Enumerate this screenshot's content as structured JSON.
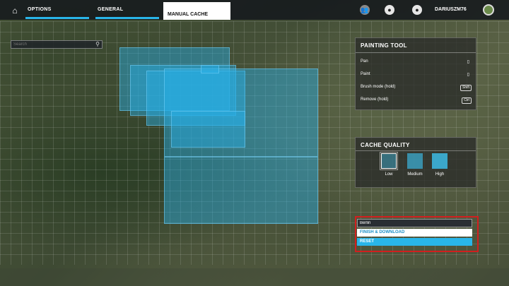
{
  "topbar": {
    "tabs": [
      "OPTIONS",
      "GENERAL"
    ],
    "active_tab": "MANUAL CACHE",
    "username": "DARIUSZM76"
  },
  "search": {
    "placeholder": "Search"
  },
  "painting_tool": {
    "title": "PAINTING TOOL",
    "rows": [
      {
        "label": "Pan",
        "key": ""
      },
      {
        "label": "Paint",
        "key": ""
      },
      {
        "label": "Brush mode (hold)",
        "key": "Shift"
      },
      {
        "label": "Remove (hold)",
        "key": "Ctrl"
      }
    ]
  },
  "cache_quality": {
    "title": "CACHE QUALITY",
    "options": [
      "Low",
      "Medium",
      "High"
    ],
    "selected": "Low"
  },
  "actions": {
    "name_value": "Berlin",
    "finish_label": "FINISH & DOWNLOAD",
    "reset_label": "RESET"
  },
  "colors": {
    "accent": "#29b6e9",
    "highlight_border": "#d11f1f"
  }
}
